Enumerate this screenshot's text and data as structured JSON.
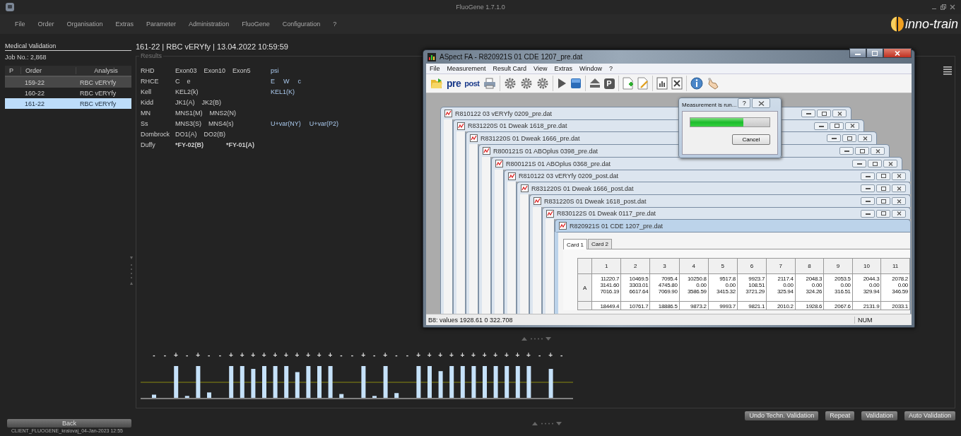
{
  "app": {
    "title": "FluoGene 1.7.1.0",
    "menu": [
      "File",
      "Order",
      "Organisation",
      "Extras",
      "Parameter",
      "Administration",
      "FluoGene",
      "Configuration",
      "?"
    ],
    "logo": "inno-train"
  },
  "sidebar": {
    "title": "Medical Validation",
    "job": "Job No.: 2,868",
    "columns": [
      "P",
      "Order",
      "Analysis"
    ],
    "rows": [
      {
        "order": "159-22",
        "analysis": "RBC vERYfy",
        "selected": false,
        "marked": true
      },
      {
        "order": "160-22",
        "analysis": "RBC vERYfy",
        "selected": false,
        "marked": false
      },
      {
        "order": "161-22",
        "analysis": "RBC vERYfy",
        "selected": true,
        "marked": false
      }
    ]
  },
  "header": "161-22  |  RBC vERYfy  |  13.04.2022 10:59:59",
  "results": {
    "title": "Results",
    "rows": [
      {
        "label": "RHD",
        "left": [
          "Exon03",
          "Exon10",
          "Exon5"
        ],
        "right": [
          "psi"
        ],
        "bold": false
      },
      {
        "label": "RHCE",
        "left": [
          "C",
          "e"
        ],
        "right": [
          "E",
          "W",
          "c"
        ],
        "bold": false
      },
      {
        "label": "Kell",
        "left": [
          "KEL2(k)"
        ],
        "right": [
          "KEL1(K)"
        ],
        "bold": false
      },
      {
        "label": "Kidd",
        "left": [
          "JK1(A)",
          "JK2(B)"
        ],
        "right": [],
        "bold": false
      },
      {
        "label": "MN",
        "left": [
          "MNS1(M)",
          "MNS2(N)"
        ],
        "right": [],
        "bold": false
      },
      {
        "label": "Ss",
        "left": [
          "MNS3(S)",
          "MNS4(s)"
        ],
        "right": [
          "U+var(NY)",
          "U+var(P2)"
        ],
        "bold": false
      },
      {
        "label": "Dombrock",
        "left": [
          "DO1(A)",
          "DO2(B)"
        ],
        "right": [],
        "bold": false
      },
      {
        "label": "Duffy",
        "left": [
          "*FY-02(B)",
          "*FY-01(A)"
        ],
        "right": [],
        "bold": true
      }
    ]
  },
  "chart": {
    "signs": [
      "-",
      "-",
      "+",
      "-",
      "+",
      "-",
      "-",
      "+",
      "+",
      "+",
      "+",
      "+",
      "+",
      "+",
      "+",
      "+",
      "+",
      "-",
      "-",
      "+",
      "-",
      "+",
      "-",
      "-",
      "+",
      "+",
      "+",
      "+",
      "+",
      "+",
      "+",
      "+",
      "+",
      "+",
      "+",
      "-",
      "+",
      "-"
    ]
  },
  "back": "Back",
  "actions": [
    "Undo Techn. Validation",
    "Repeat",
    "Validation",
    "Auto Validation"
  ],
  "status": "CLIENT_FLUOGENE_kralovaj_04-Jan-2023 12:55",
  "aspect": {
    "title": "ASpect FA - R820921S 01 CDE 1207_pre.dat",
    "menu": [
      "File",
      "Measurement",
      "Result Card",
      "View",
      "Extras",
      "Window",
      "?"
    ],
    "toolbar": [
      {
        "kind": "folder"
      },
      {
        "kind": "text",
        "label": "pre"
      },
      {
        "kind": "text",
        "label": "post"
      },
      {
        "kind": "printer"
      },
      {
        "kind": "sep"
      },
      {
        "kind": "gear"
      },
      {
        "kind": "gear"
      },
      {
        "kind": "gear"
      },
      {
        "kind": "sep"
      },
      {
        "kind": "play"
      },
      {
        "kind": "stop"
      },
      {
        "kind": "sep"
      },
      {
        "kind": "eject"
      },
      {
        "kind": "letter",
        "label": "P"
      },
      {
        "kind": "sep"
      },
      {
        "kind": "doc-add"
      },
      {
        "kind": "doc-edit"
      },
      {
        "kind": "sep"
      },
      {
        "kind": "doc-chart"
      },
      {
        "kind": "sheet"
      },
      {
        "kind": "sep"
      },
      {
        "kind": "info"
      },
      {
        "kind": "hand"
      }
    ],
    "children": [
      {
        "title": "R810122 03 vERYfy 0209_pre.dat",
        "active": false
      },
      {
        "title": "R831220S 01 Dweak 1618_pre.dat",
        "active": false
      },
      {
        "title": "R831220S 01 Dweak 1666_pre.dat",
        "active": false
      },
      {
        "title": "R800121S 01 ABOplus 0398_pre.dat",
        "active": false
      },
      {
        "title": "R800121S 01 ABOplus 0368_pre.dat",
        "active": false
      },
      {
        "title": "R810122 03 vERYfy 0209_post.dat",
        "active": false
      },
      {
        "title": "R831220S 01 Dweak 1666_post.dat",
        "active": false
      },
      {
        "title": "R831220S 01 Dweak 1618_post.dat",
        "active": false
      },
      {
        "title": "R830122S 01 Dweak 0117_pre.dat",
        "active": false
      },
      {
        "title": "R820921S 01 CDE 1207_pre.dat",
        "active": true
      }
    ],
    "dialog": {
      "title": "Measurement is run...",
      "help": "?",
      "level": 0.67,
      "button": "Cancel"
    },
    "tabs": [
      {
        "label": "Card 1",
        "selected": true
      },
      {
        "label": "Card 2",
        "selected": false
      }
    ],
    "grid": {
      "columns": [
        "1",
        "2",
        "3",
        "4",
        "5",
        "6",
        "7",
        "8",
        "9",
        "10",
        "11"
      ],
      "rows": [
        {
          "label": "A",
          "cells": [
            [
              "11220.7",
              "3141.60",
              "7016.19"
            ],
            [
              "10469.5",
              "3303.01",
              "6617.64"
            ],
            [
              "7095.4",
              "4745.80",
              "7069.90"
            ],
            [
              "10250.8",
              "0.00",
              "3586.59"
            ],
            [
              "9517.8",
              "0.00",
              "3415.32"
            ],
            [
              "9923.7",
              "108.51",
              "3721.29"
            ],
            [
              "2117.4",
              "0.00",
              "325.94"
            ],
            [
              "2048.3",
              "0.00",
              "324.26"
            ],
            [
              "2053.5",
              "0.00",
              "316.51"
            ],
            [
              "2044.3",
              "0.00",
              "329.94"
            ],
            [
              "2078.2",
              "0.00",
              "346.59"
            ]
          ]
        },
        {
          "cells": [
            [
              "18449.4"
            ],
            [
              "10761.7"
            ],
            [
              "18886.5"
            ],
            [
              "9873.2"
            ],
            [
              "9993.7"
            ],
            [
              "9821.1"
            ],
            [
              "2010.2"
            ],
            [
              "1928.6"
            ],
            [
              "2067.6"
            ],
            [
              "2131.9"
            ],
            [
              "2033.1"
            ]
          ]
        }
      ]
    },
    "status": "B8: values 1928.61 0 322.708",
    "indicator": "NUM"
  }
}
